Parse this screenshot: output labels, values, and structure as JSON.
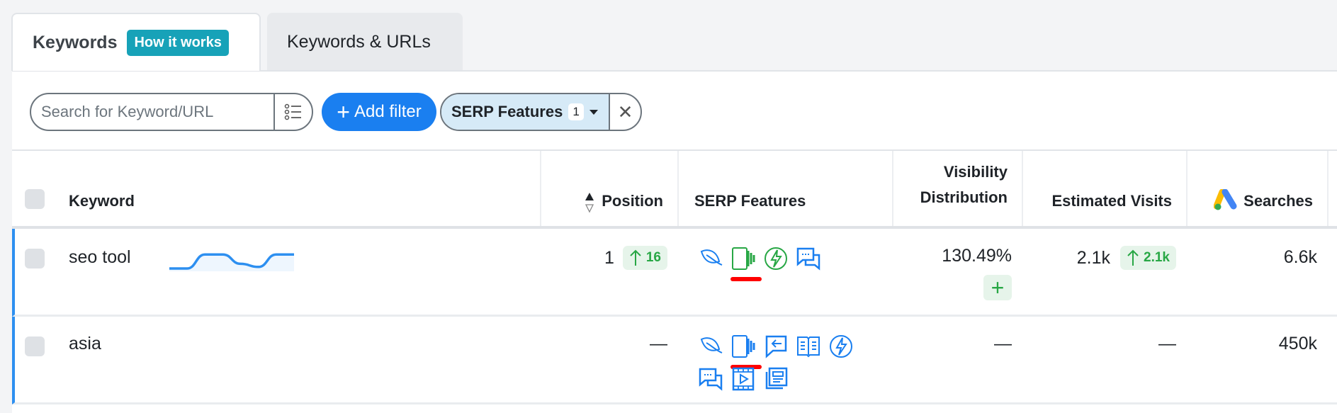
{
  "tabs": [
    {
      "label": "Keywords",
      "badge": "How it works",
      "active": true
    },
    {
      "label": "Keywords & URLs",
      "active": false
    }
  ],
  "toolbar": {
    "search_placeholder": "Search for Keyword/URL",
    "search_value": "",
    "add_filter_label": "Add filter",
    "filter_chip": {
      "label": "SERP Features",
      "count": "1"
    },
    "close_symbol": "✕"
  },
  "table": {
    "headers": {
      "keyword": "Keyword",
      "position": "Position",
      "serp": "SERP Features",
      "visibility_line1": "Visibility",
      "visibility_line2": "Distribution",
      "visits": "Estimated Visits",
      "searches": "Searches"
    },
    "rows": [
      {
        "keyword": "seo tool",
        "trend": [
          0,
          0,
          0.9,
          0.9,
          0.3,
          0.1,
          0.9,
          0.9
        ],
        "position": "1",
        "position_delta": "16",
        "serp_features": [
          {
            "icon": "leaf-icon",
            "color": "#1a7ff0"
          },
          {
            "icon": "carousel-icon",
            "color": "#28a745",
            "highlighted": true
          },
          {
            "icon": "amp-icon",
            "color": "#28a745"
          },
          {
            "icon": "reviews-chat-icon",
            "color": "#1a7ff0"
          }
        ],
        "visibility": "130.49%",
        "visits": "2.1k",
        "visits_delta": "2.1k",
        "searches": "6.6k"
      },
      {
        "keyword": "asia",
        "position": "—",
        "serp_features": [
          {
            "icon": "leaf-icon",
            "color": "#1a7ff0"
          },
          {
            "icon": "carousel-icon",
            "color": "#1a7ff0",
            "highlighted": true
          },
          {
            "icon": "featured-reply-icon",
            "color": "#1a7ff0"
          },
          {
            "icon": "knowledge-book-icon",
            "color": "#1a7ff0"
          },
          {
            "icon": "amp-icon",
            "color": "#1a7ff0"
          },
          {
            "icon": "reviews-chat-icon",
            "color": "#1a7ff0"
          },
          {
            "icon": "video-icon",
            "color": "#1a7ff0"
          },
          {
            "icon": "top-stories-icon",
            "color": "#1a7ff0"
          }
        ],
        "visibility": "—",
        "visits": "—",
        "searches": "450k"
      }
    ]
  },
  "colors": {
    "accent": "#1a7ff0",
    "positive": "#28a745",
    "badge": "#17a2b8",
    "highlight": "#ff0000"
  }
}
